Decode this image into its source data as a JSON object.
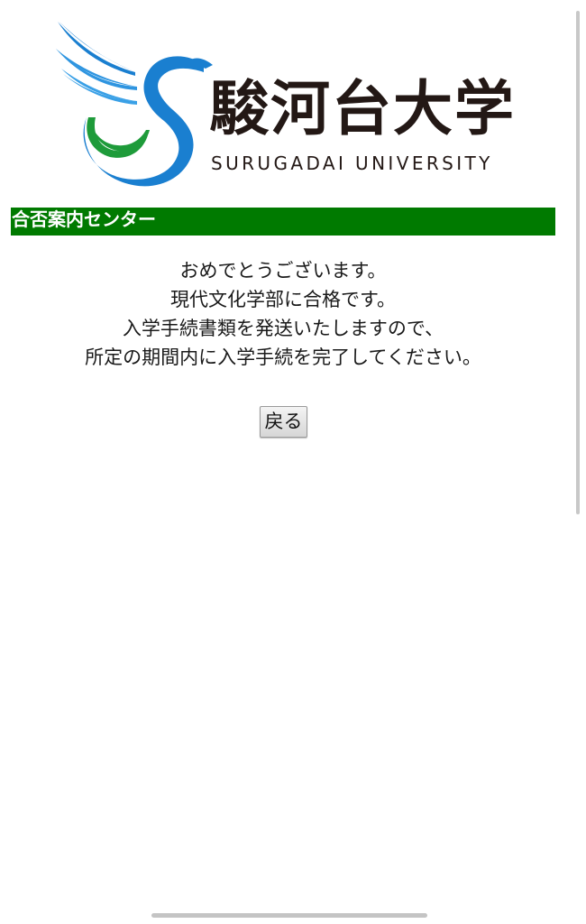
{
  "logo": {
    "name_ja": "駿河台大学",
    "name_en": "SURUGADAI UNIVERSITY",
    "colors": {
      "blue": "#1a7fd0",
      "light_blue": "#3aa0e6",
      "green": "#1e9b3a",
      "text": "#231815"
    }
  },
  "section": {
    "title": "合否案内センター",
    "background": "#007a00"
  },
  "message": {
    "line1": "おめでとうございます。",
    "line2": "現代文化学部に合格です。",
    "line3": "入学手続書類を発送いたしますので、",
    "line4": "所定の期間内に入学手続を完了してください。"
  },
  "actions": {
    "back_label": "戻る"
  }
}
